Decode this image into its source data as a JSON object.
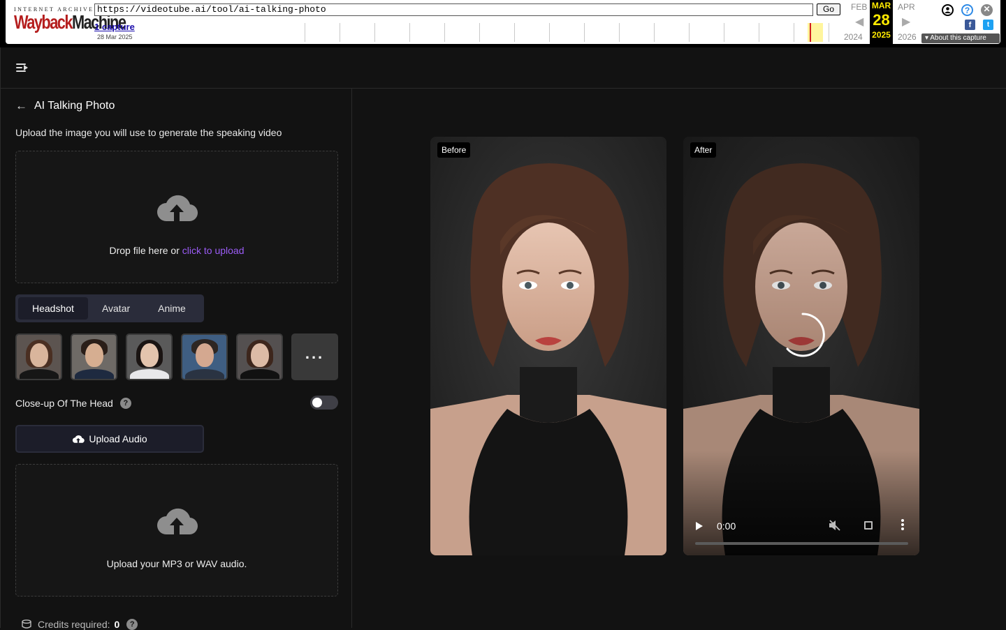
{
  "wayback": {
    "logo_top": "INTERNET ARCHIVE",
    "logo_main_a": "Wayback",
    "logo_main_b": "Machine",
    "url": "https://videotube.ai/tool/ai-talking-photo",
    "go_label": "Go",
    "captures": "1 capture",
    "capture_date": "28 Mar 2025",
    "prev_month": "FEB",
    "cur_month": "MAR",
    "next_month": "APR",
    "cur_day": "28",
    "prev_year": "2024",
    "cur_year": "2025",
    "next_year": "2026",
    "about": "About this capture"
  },
  "panel": {
    "title": "AI Talking Photo",
    "subtitle": "Upload the image you will use to generate the speaking video",
    "image_drop": {
      "text": "Drop file here or ",
      "link": "click to upload"
    },
    "tabs": [
      {
        "label": "Headshot",
        "active": true
      },
      {
        "label": "Avatar",
        "active": false
      },
      {
        "label": "Anime",
        "active": false
      }
    ],
    "more_label": "...",
    "closeup_label": "Close-up Of The Head",
    "help_label": "?",
    "closeup_enabled": false,
    "upload_audio_label": "Upload Audio",
    "audio_drop_text": "Upload your MP3 or WAV audio.",
    "credits_label": "Credits required:",
    "credits_value": "0"
  },
  "preview": {
    "before_label": "Before",
    "after_label": "After",
    "video_time": "0:00",
    "video_progress": 0
  }
}
